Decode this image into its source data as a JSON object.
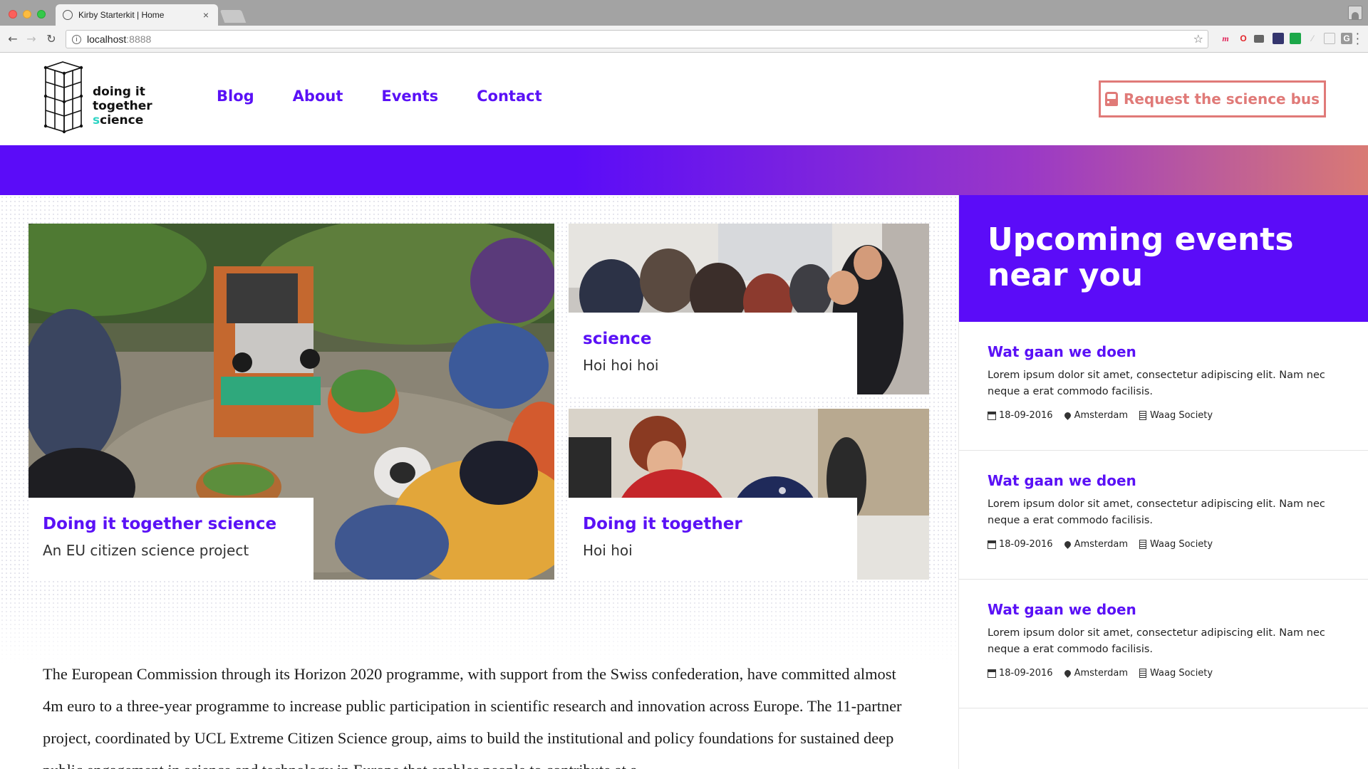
{
  "browser": {
    "tab_title": "Kirby Starterkit | Home",
    "tab_close": "×",
    "url_host": "localhost",
    "url_port": ":8888",
    "extensions": [
      "m",
      "o",
      "print-icon",
      "reader-icon",
      "shield-icon",
      "feather-icon",
      "grid-icon",
      "G"
    ]
  },
  "header": {
    "logo_line1": "doing it",
    "logo_line2": "together",
    "logo_line3_accent": "s",
    "logo_line3_rest": "cience",
    "nav": [
      "Blog",
      "About",
      "Events",
      "Contact"
    ],
    "cta_label": "Request the science bus",
    "colors": {
      "primary": "#5a11f6",
      "cta": "#e07a78",
      "accent": "#2fd4c4"
    }
  },
  "cards": [
    {
      "title": "Doing it together science",
      "subtitle": "An EU citizen science project"
    },
    {
      "title": "science",
      "subtitle": "Hoi hoi hoi"
    },
    {
      "title": "Doing it together",
      "subtitle": "Hoi hoi"
    }
  ],
  "body_text": "The European Commission through its Horizon 2020 programme, with support from the Swiss confederation, have committed almost 4m euro to a three-year programme to increase public participation in scientific research and innovation across Europe. The 11-partner project, coordinated by UCL Extreme Citizen Science group, aims to build the institutional and policy foundations for sustained deep public engagement in science and technology in Europe that enables people to contribute at a",
  "sidebar": {
    "title": "Upcoming events near you",
    "events": [
      {
        "title": "Wat gaan we doen",
        "description": "Lorem ipsum dolor sit amet, consectetur adipiscing elit. Nam nec neque a erat commodo facilisis.",
        "date": "18-09-2016",
        "location": "Amsterdam",
        "venue": "Waag Society"
      },
      {
        "title": "Wat gaan we doen",
        "description": "Lorem ipsum dolor sit amet, consectetur adipiscing elit. Nam nec neque a erat commodo facilisis.",
        "date": "18-09-2016",
        "location": "Amsterdam",
        "venue": "Waag Society"
      },
      {
        "title": "Wat gaan we doen",
        "description": "Lorem ipsum dolor sit amet, consectetur adipiscing elit. Nam nec neque a erat commodo facilisis.",
        "date": "18-09-2016",
        "location": "Amsterdam",
        "venue": "Waag Society"
      }
    ]
  }
}
